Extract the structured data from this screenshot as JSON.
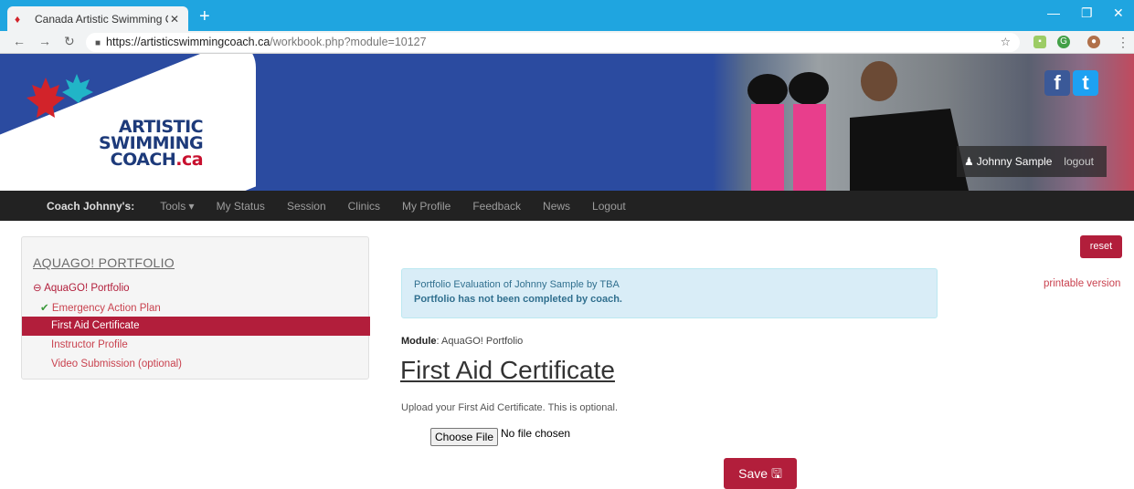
{
  "browser": {
    "tab_title": "Canada Artistic Swimming Coach",
    "new_tab": "+",
    "url_host": "https://artisticswimmingcoach.ca",
    "url_path": "/workbook.php?module=10127"
  },
  "header": {
    "logo_line1": "ARTISTIC",
    "logo_line2": "SWIMMING",
    "logo_line3": "COACH",
    "logo_ca": ".ca",
    "user_name": "Johnny Sample",
    "logout": "logout",
    "colors": {
      "brand_blue": "#2b4ba0",
      "brand_red": "#c8102e"
    }
  },
  "nav": {
    "brand": "Coach Johnny's:",
    "items": [
      "Tools ▾",
      "My Status",
      "Session",
      "Clinics",
      "My Profile",
      "Feedback",
      "News",
      "Logout"
    ]
  },
  "sidebar": {
    "heading": "AQUAGO! PORTFOLIO",
    "section": "AquaGO! Portfolio",
    "items": [
      {
        "label": "Emergency Action Plan",
        "done": true
      },
      {
        "label": "First Aid Certificate",
        "active": true
      },
      {
        "label": "Instructor Profile"
      },
      {
        "label": "Video Submission (optional)"
      }
    ]
  },
  "main": {
    "reset": "reset",
    "printable": "printable version",
    "alert_line1": "Portfolio Evaluation of Johnny Sample by TBA",
    "alert_line2": "Portfolio has not been completed by coach.",
    "module_label": "Module",
    "module_value": ": AquaGO! Portfolio",
    "title": "First Aid Certificate",
    "description": "Upload your First Aid Certificate. This is optional.",
    "choose_file": "Choose File",
    "no_file": "No file chosen",
    "save": "Save",
    "accent": "#b21e3b"
  }
}
